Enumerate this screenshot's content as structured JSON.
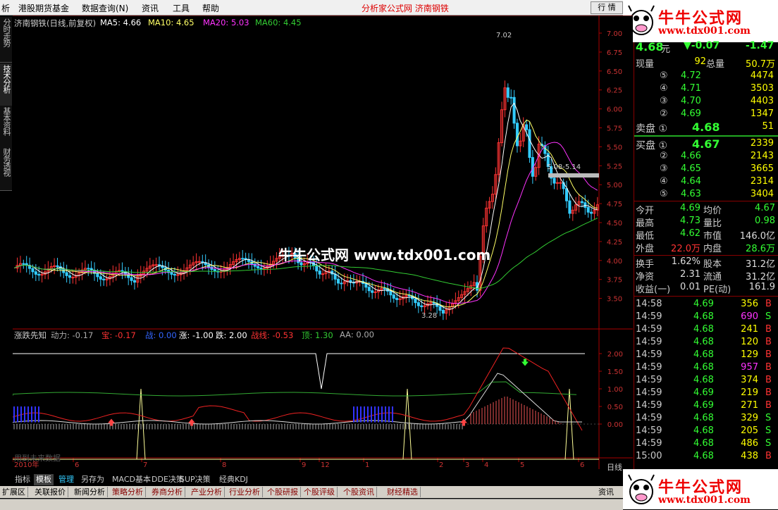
{
  "menu": {
    "items": [
      "析",
      "港股期货基金",
      "数据查询(N)",
      "资讯",
      "工具",
      "帮助"
    ],
    "title": "分析家公式网  济南钢铁",
    "quote_button": "行 情"
  },
  "logo": {
    "title": "牛牛公式网",
    "url": "www.tdx001.com"
  },
  "left_tabs": [
    "分时走势",
    "技术分析",
    "基本资料",
    "财务透视"
  ],
  "chart_header": {
    "name": "济南钢铁(日线,前复权)",
    "ma5": "MA5: 4.66",
    "ma10": "MA10: 4.65",
    "ma20": "MA20: 5.03",
    "ma60": "MA60: 4.45"
  },
  "colors": {
    "ma5": "#ffffff",
    "ma10": "#ffff66",
    "ma20": "#ff33ff",
    "ma60": "#33cc33",
    "up": "#ff3333",
    "down": "#33ccff",
    "axis": "#aa0000"
  },
  "price_axis": [
    "7.00",
    "6.75",
    "6.50",
    "6.25",
    "6.00",
    "5.75",
    "5.50",
    "5.25",
    "5.00",
    "4.75",
    "4.50",
    "4.25",
    "4.00",
    "3.75",
    "3.50"
  ],
  "annotations": {
    "high": "7.02",
    "low": "3.28",
    "range": "5.08-5.14"
  },
  "watermark": "牛牛公式网 www.tdx001.com",
  "indicator_header": {
    "name": "涨跌先知",
    "dongli": "动力: -0.17",
    "bao": "宝: -0.17",
    "zhan": "战: 0.00",
    "zhang": "涨: -1.00",
    "die": "跌: 2.00",
    "zhanxian": "战线: -0.53",
    "ding": "顶: 1.30",
    "aa": "AA: 0.00"
  },
  "indicator_axis": [
    "2.00",
    "1.50",
    "1.00",
    "0.50",
    "0.00"
  ],
  "indicator_note": "用到未来数据",
  "date_axis": [
    "2010年",
    "6",
    "7",
    "8",
    "9",
    "12",
    "1",
    "2",
    "3",
    "4",
    "5",
    "6"
  ],
  "period_label": "日线",
  "quote": {
    "price": "4.68",
    "price_unit": "元",
    "change": "▼-0.07",
    "pct": "-1.47",
    "xianliang_label": "现量",
    "xianliang": "92",
    "zongliang_label": "总量",
    "zongliang": "50.7万",
    "sell": [
      {
        "lvl": "⑤",
        "price": "4.72",
        "vol": "4474"
      },
      {
        "lvl": "④",
        "price": "4.71",
        "vol": "3503"
      },
      {
        "lvl": "③",
        "price": "4.70",
        "vol": "4403"
      },
      {
        "lvl": "②",
        "price": "4.69",
        "vol": "1347"
      },
      {
        "lvl": "卖盘 ①",
        "price": "4.68",
        "vol": "51"
      }
    ],
    "buy": [
      {
        "lvl": "买盘 ①",
        "price": "4.67",
        "vol": "2339"
      },
      {
        "lvl": "②",
        "price": "4.66",
        "vol": "2143"
      },
      {
        "lvl": "③",
        "price": "4.65",
        "vol": "3665"
      },
      {
        "lvl": "④",
        "price": "4.64",
        "vol": "2314"
      },
      {
        "lvl": "⑤",
        "price": "4.63",
        "vol": "3404"
      }
    ],
    "stats": [
      {
        "l1": "今开",
        "v1": "4.69",
        "l2": "均价",
        "v2": "4.67"
      },
      {
        "l1": "最高",
        "v1": "4.73",
        "l2": "量比",
        "v2": "0.98"
      },
      {
        "l1": "最低",
        "v1": "4.62",
        "l2": "市值",
        "v2": "146.0亿"
      },
      {
        "l1": "外盘",
        "v1": "22.0万",
        "l2": "内盘",
        "v2": "28.6万"
      }
    ],
    "stats2": [
      {
        "l1": "换手",
        "v1": "1.62%",
        "l2": "股本",
        "v2": "31.2亿"
      },
      {
        "l1": "净资",
        "v1": "2.31",
        "l2": "流通",
        "v2": "31.2亿"
      },
      {
        "l1": "收益(一)",
        "v1": "0.01",
        "l2": "PE(动)",
        "v2": "161.9"
      }
    ]
  },
  "ticks": [
    {
      "t": "14:58",
      "p": "4.69",
      "v": "356",
      "bs": "B"
    },
    {
      "t": "14:59",
      "p": "4.68",
      "v": "690",
      "bs": "S"
    },
    {
      "t": "14:59",
      "p": "4.68",
      "v": "241",
      "bs": "B"
    },
    {
      "t": "14:59",
      "p": "4.68",
      "v": "120",
      "bs": "B"
    },
    {
      "t": "14:59",
      "p": "4.68",
      "v": "129",
      "bs": "B"
    },
    {
      "t": "14:59",
      "p": "4.68",
      "v": "957",
      "bs": "B"
    },
    {
      "t": "14:59",
      "p": "4.68",
      "v": "374",
      "bs": "B"
    },
    {
      "t": "14:59",
      "p": "4.69",
      "v": "219",
      "bs": "B"
    },
    {
      "t": "14:59",
      "p": "4.69",
      "v": "271",
      "bs": "B"
    },
    {
      "t": "14:59",
      "p": "4.68",
      "v": "329",
      "bs": "S"
    },
    {
      "t": "14:59",
      "p": "4.68",
      "v": "205",
      "bs": "S"
    },
    {
      "t": "14:59",
      "p": "4.68",
      "v": "486",
      "bs": "S"
    },
    {
      "t": "15:00",
      "p": "4.68",
      "v": "438",
      "bs": "B"
    },
    {
      "t": "15:00",
      "p": "4.68",
      "v": "93",
      "bs": "S"
    }
  ],
  "bottom_tabs": [
    "指标",
    "模板",
    "管理",
    "另存为",
    "MACD基本",
    "DDE决策",
    "SUP决策",
    "经典KDJ"
  ],
  "info_tabs": [
    "扩展区",
    "关联报价",
    "新闻分析",
    "策略分析",
    "券商分析",
    "产业分析",
    "行业分析",
    "个股研报",
    "个股评级",
    "个股资讯",
    "财经精选"
  ],
  "info_right": "资讯工"
}
